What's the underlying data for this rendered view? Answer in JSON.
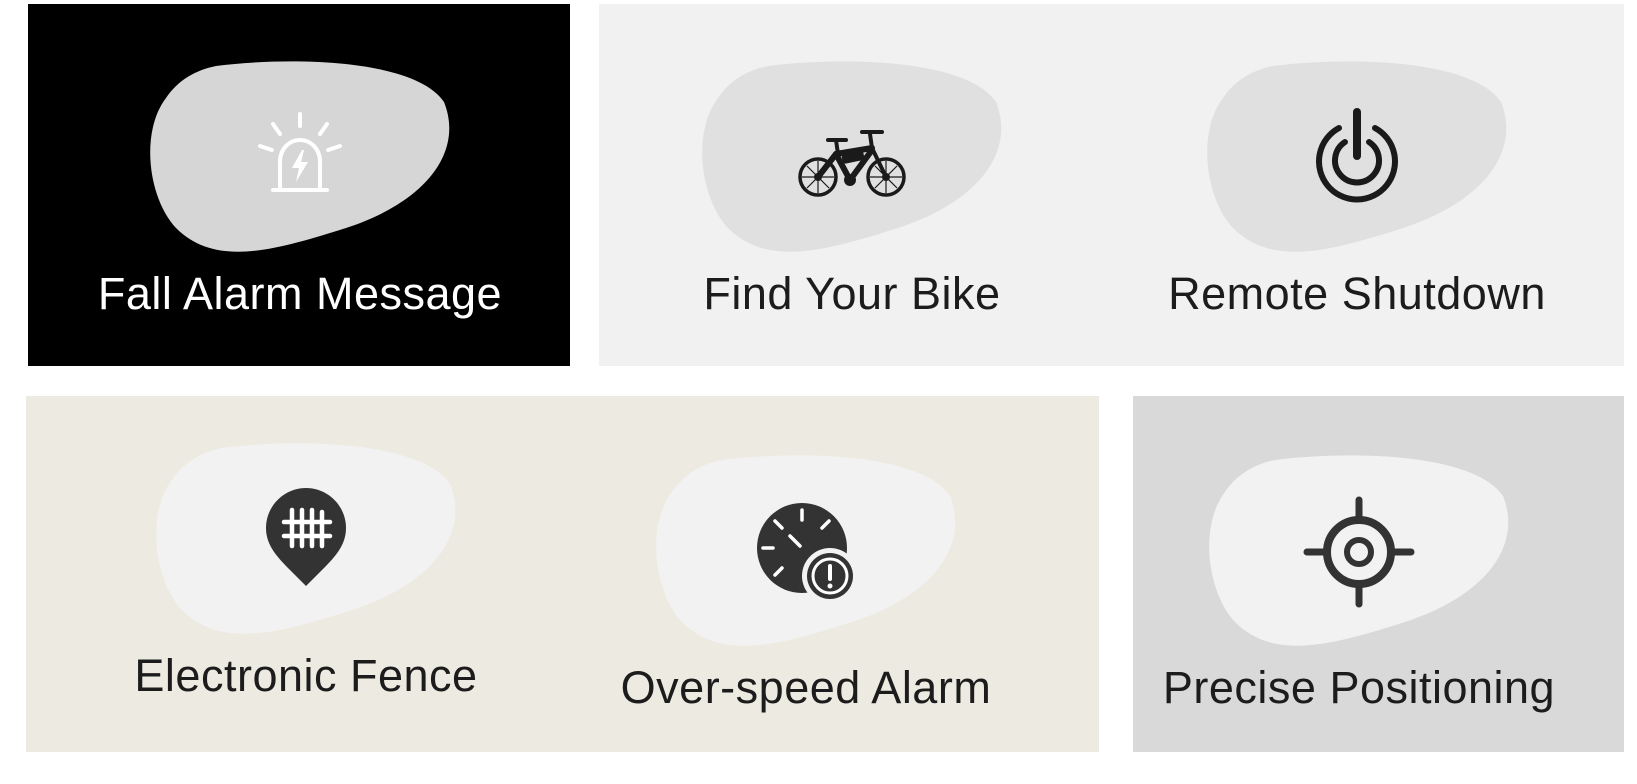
{
  "features": [
    {
      "label": "Fall Alarm Message",
      "icon": "alarm-siren-icon",
      "panel_color": "#000000",
      "blob_color": "#d6d6d6",
      "icon_color": "#ffffff"
    },
    {
      "label": "Find Your Bike",
      "icon": "bicycle-icon",
      "panel_color": "#f1f1f1",
      "blob_color": "#e0e0e0",
      "icon_color": "#1a1a1a"
    },
    {
      "label": "Remote Shutdown",
      "icon": "power-icon",
      "panel_color": "#f1f1f1",
      "blob_color": "#e0e0e0",
      "icon_color": "#1a1a1a"
    },
    {
      "label": "Electronic Fence",
      "icon": "fence-location-pin-icon",
      "panel_color": "#edebe1",
      "blob_color": "#f2f2f2",
      "icon_color": "#333333"
    },
    {
      "label": "Over-speed Alarm",
      "icon": "speedometer-alert-icon",
      "panel_color": "#edebe1",
      "blob_color": "#f2f2f2",
      "icon_color": "#333333"
    },
    {
      "label": "Precise Positioning",
      "icon": "crosshair-target-icon",
      "panel_color": "#d9d9d9",
      "blob_color": "#f2f2f2",
      "icon_color": "#333333"
    }
  ]
}
